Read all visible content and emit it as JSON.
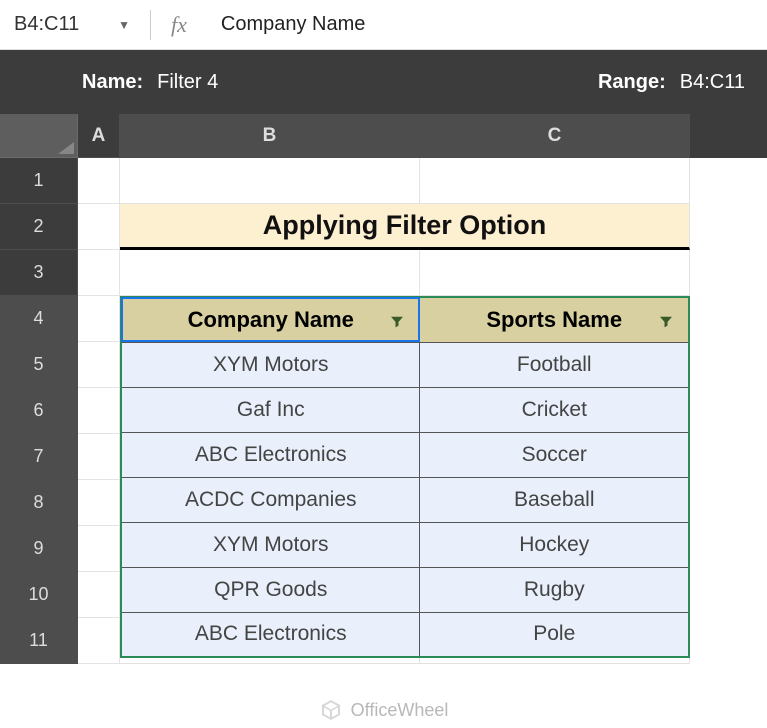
{
  "formula_bar": {
    "cell_ref": "B4:C11",
    "content": "Company Name"
  },
  "filter_header": {
    "name_label": "Name:",
    "name_value": "Filter 4",
    "range_label": "Range:",
    "range_value": "B4:C11"
  },
  "columns": {
    "A": "A",
    "B": "B",
    "C": "C"
  },
  "rows": [
    "1",
    "2",
    "3",
    "4",
    "5",
    "6",
    "7",
    "8",
    "9",
    "10",
    "11"
  ],
  "title": "Applying Filter Option",
  "table": {
    "headers": {
      "company": "Company Name",
      "sport": "Sports Name"
    },
    "rows": [
      {
        "company": "XYM Motors",
        "sport": "Football"
      },
      {
        "company": "Gaf Inc",
        "sport": "Cricket"
      },
      {
        "company": "ABC Electronics",
        "sport": "Soccer"
      },
      {
        "company": "ACDC Companies",
        "sport": "Baseball"
      },
      {
        "company": "XYM Motors",
        "sport": "Hockey"
      },
      {
        "company": "QPR Goods",
        "sport": "Rugby"
      },
      {
        "company": "ABC Electronics",
        "sport": "Pole"
      }
    ]
  },
  "watermark": "OfficeWheel"
}
